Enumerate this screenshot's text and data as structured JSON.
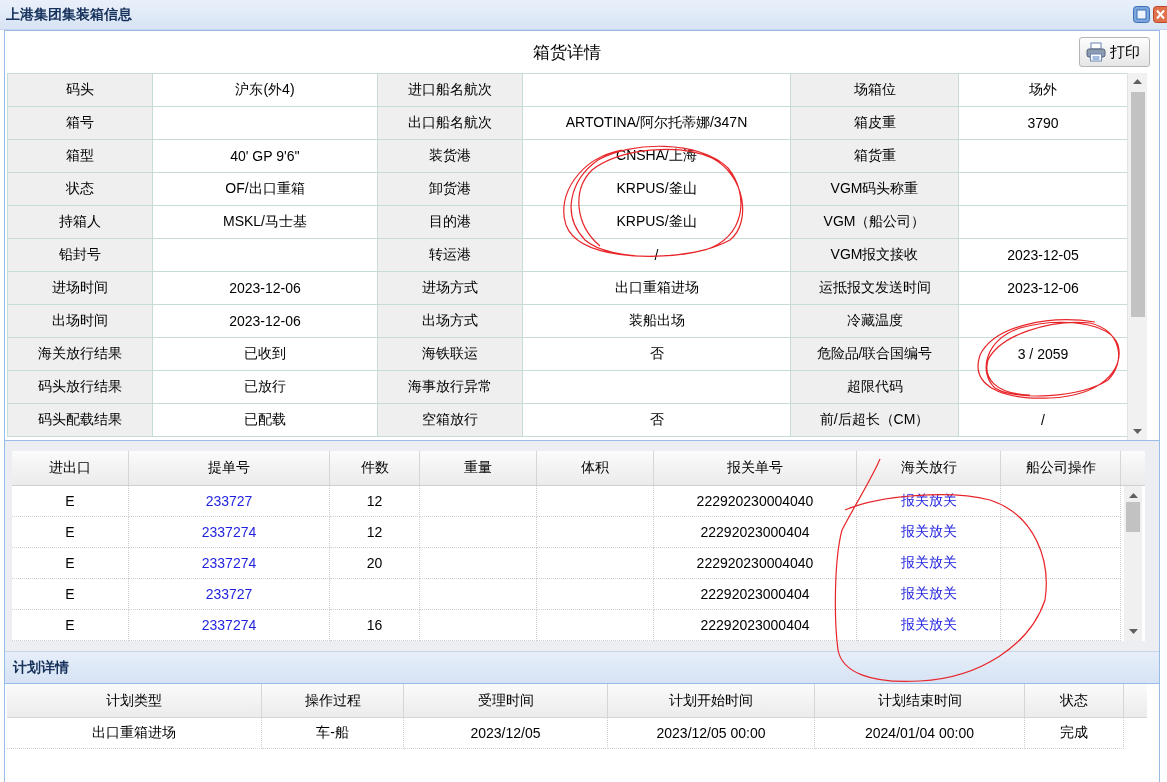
{
  "window": {
    "title": "上港集团集装箱信息"
  },
  "container_details": {
    "title": "箱货详情",
    "print_button": {
      "label": "打印"
    },
    "rows": [
      [
        {
          "label": "码头",
          "value": "沪东(外4)"
        },
        {
          "label": "进口船名航次"
        },
        {
          "label": "场箱位",
          "value": "场外"
        }
      ],
      [
        {
          "label": "箱号"
        },
        {
          "label": "出口船名航次",
          "value": "ARTOTINA/阿尔托蒂娜/347N"
        },
        {
          "label": "箱皮重",
          "value": "3790"
        }
      ],
      [
        {
          "label": "箱型",
          "value": "40' GP 9'6''"
        },
        {
          "label": "装货港",
          "value": "CNSHA/上海"
        },
        {
          "label": "箱货重"
        }
      ],
      [
        {
          "label": "状态",
          "value": "OF/出口重箱"
        },
        {
          "label": "卸货港",
          "value": "KRPUS/釜山"
        },
        {
          "label": "VGM码头称重"
        }
      ],
      [
        {
          "label": "持箱人",
          "value": "MSKL/马士基"
        },
        {
          "label": "目的港",
          "value": "KRPUS/釜山"
        },
        {
          "label": "VGM（船公司）"
        }
      ],
      [
        {
          "label": "铅封号"
        },
        {
          "label": "转运港",
          "value": "/"
        },
        {
          "label": "VGM报文接收",
          "value": "2023-12-05"
        }
      ],
      [
        {
          "label": "进场时间",
          "value": "2023-12-06"
        },
        {
          "label": "进场方式",
          "value": "出口重箱进场"
        },
        {
          "label": "运抵报文发送时间",
          "value": "2023-12-06"
        }
      ],
      [
        {
          "label": "出场时间",
          "value": "2023-12-06"
        },
        {
          "label": "出场方式",
          "value": "装船出场"
        },
        {
          "label": "冷藏温度"
        }
      ],
      [
        {
          "label": "海关放行结果",
          "value": "已收到"
        },
        {
          "label": "海铁联运",
          "value": "否"
        },
        {
          "label": "危险品/联合国编号",
          "value": "3 / 2059"
        }
      ],
      [
        {
          "label": "码头放行结果",
          "value": "已放行"
        },
        {
          "label": "海事放行异常"
        },
        {
          "label": "超限代码"
        }
      ],
      [
        {
          "label": "码头配载结果",
          "value": "已配载"
        },
        {
          "label": "空箱放行",
          "value": "否"
        },
        {
          "label": "前/后超长（CM）",
          "value": "/"
        }
      ]
    ]
  },
  "cargo_grid": {
    "columns": [
      "进出口",
      "提单号",
      "件数",
      "重量",
      "体积",
      "报关单号",
      "海关放行",
      "船公司操作"
    ],
    "rows": [
      {
        "direction": "E",
        "bill_no": "233727",
        "pieces": "12",
        "customs_declaration_no": "222920230004040",
        "customs_release": "报关放关"
      },
      {
        "direction": "E",
        "bill_no": "2337274",
        "pieces": "12",
        "customs_declaration_no": "22292023000404",
        "customs_release": "报关放关"
      },
      {
        "direction": "E",
        "bill_no": "2337274",
        "pieces": "20",
        "customs_declaration_no": "222920230004040",
        "customs_release": "报关放关"
      },
      {
        "direction": "E",
        "bill_no": "233727",
        "customs_declaration_no": "22292023000404",
        "customs_release": "报关放关"
      },
      {
        "direction": "E",
        "bill_no": "2337274",
        "pieces": "16",
        "customs_declaration_no": "22292023000404",
        "customs_release": "报关放关"
      }
    ]
  },
  "plan_details": {
    "title": "计划详情",
    "columns": [
      "计划类型",
      "操作过程",
      "受理时间",
      "计划开始时间",
      "计划结束时间",
      "状态"
    ],
    "rows": [
      [
        "出口重箱进场",
        "车-船",
        "2023/12/05",
        "2023/12/05 00:00",
        "2024/01/04 00:00",
        "完成"
      ]
    ]
  }
}
